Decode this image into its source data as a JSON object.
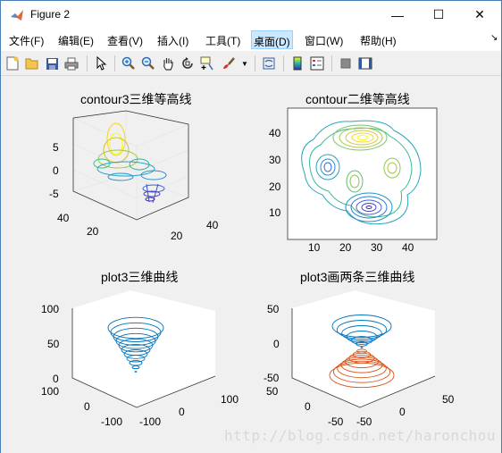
{
  "window": {
    "title": "Figure 2",
    "minimize_glyph": "—",
    "maximize_glyph": "☐",
    "close_glyph": "✕"
  },
  "menubar": {
    "items": [
      "文件(F)",
      "编辑(E)",
      "查看(V)",
      "插入(I)",
      "工具(T)",
      "桌面(D)",
      "窗口(W)",
      "帮助(H)"
    ],
    "active": "桌面(D)",
    "dock_glyph": "↘"
  },
  "toolbar": {
    "icons": [
      "new-file-icon",
      "open-folder-icon",
      "save-icon",
      "print-icon",
      "pointer-icon",
      "zoom-in-icon",
      "zoom-out-icon",
      "pan-hand-icon",
      "rotate-3d-icon",
      "data-cursor-icon",
      "brush-icon",
      "dropdown-arrow-icon",
      "link-plot-icon",
      "colorbar-icon",
      "legend-icon",
      "hide-plot-tools-icon",
      "show-plot-tools-icon"
    ]
  },
  "plots": {
    "p1": {
      "title": "contour3三维等高线",
      "zticks": [
        "5",
        "0",
        "-5"
      ],
      "yticks": [
        "40",
        "20"
      ],
      "xticks": [
        "20",
        "40"
      ]
    },
    "p2": {
      "title": "contour二维等高线",
      "yticks": [
        "40",
        "30",
        "20",
        "10"
      ],
      "xticks": [
        "10",
        "20",
        "30",
        "40"
      ]
    },
    "p3": {
      "title": "plot3三维曲线",
      "zticks": [
        "100",
        "50",
        "0"
      ],
      "yticks": [
        "100",
        "0",
        "-100"
      ],
      "xticks": [
        "-100",
        "0",
        "100"
      ]
    },
    "p4": {
      "title": "plot3画两条三维曲线",
      "zticks": [
        "50",
        "0",
        "-50"
      ],
      "yticks": [
        "50",
        "0",
        "-50"
      ],
      "xticks": [
        "-50",
        "0",
        "50"
      ]
    }
  },
  "watermark": "http://blog.csdn.net/haronchou",
  "colors": {
    "series1": "#0072bd",
    "series2": "#d95319",
    "active_menu": "#cce8ff"
  }
}
